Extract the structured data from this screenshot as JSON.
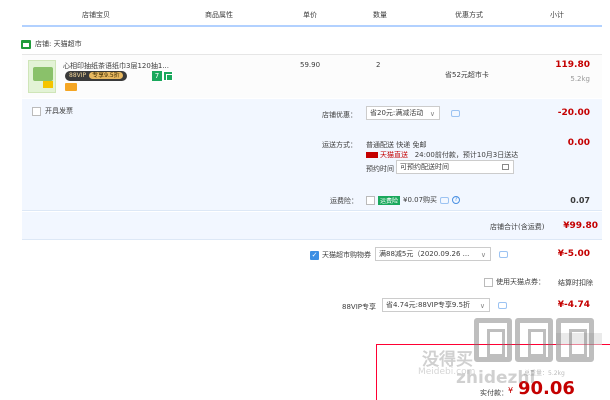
{
  "header": {
    "columns": [
      "店铺宝贝",
      "商品属性",
      "单价",
      "数量",
      "优惠方式",
      "小计"
    ]
  },
  "shop": {
    "label": "店铺: 天猫超市"
  },
  "item": {
    "title": "心相印抽纸茶语纸巾3层120抽1...",
    "vip_label": "88VIP",
    "vip_discount": "专享9.5折",
    "badge_7": "7",
    "price": "59.90",
    "quantity": "2",
    "promo": "省52元超市卡",
    "subtotal": "119.80",
    "weight": "5.2kg"
  },
  "options": {
    "invoice_label": "开具发票",
    "shop_discount_label": "店铺优惠：",
    "shop_discount_value": "省20元:满减活动",
    "shop_discount_amount": "-20.00",
    "delivery_label": "运送方式：",
    "delivery_line1": "普通配送 快递 免邮",
    "delivery_tmall": "天猫直送",
    "delivery_line2": "24:00前付款，预计10月3日送达",
    "appointment_label": "预约时间",
    "appointment_placeholder": "可预约配送时间",
    "delivery_amount": "0.00",
    "insurance_label": "运费险：",
    "insurance_tag": "运费险",
    "insurance_text": "¥0.07购买",
    "insurance_amount": "0.07"
  },
  "shop_total": {
    "label": "店铺合计(含运费)",
    "value": "¥99.80"
  },
  "global": {
    "coupon_label": "天猫超市购物券",
    "coupon_value": "满88减5元（2020.09.26 ...",
    "coupon_amount": "¥-5.00",
    "tmall_points_label": "使用天猫点券：",
    "tmall_points_value": "结算时扣除",
    "vip_label": "88VIP专享",
    "vip_value": "省4.74元:88VIP专享9.5折",
    "vip_amount": "¥-4.74"
  },
  "final": {
    "label": "实付款：",
    "symbol": "¥",
    "value": "90.06",
    "weight": "总重量：5.2kg"
  },
  "watermark": {
    "text_cn": "没得买",
    "text_en": "Meidebi.com",
    "text_site": "zhidezhi"
  },
  "colors": {
    "accent_red": "#c40000",
    "accent_blue": "#3b8ee3",
    "tmall_green": "#19a85c",
    "panel_bg": "#f2f7ff"
  }
}
